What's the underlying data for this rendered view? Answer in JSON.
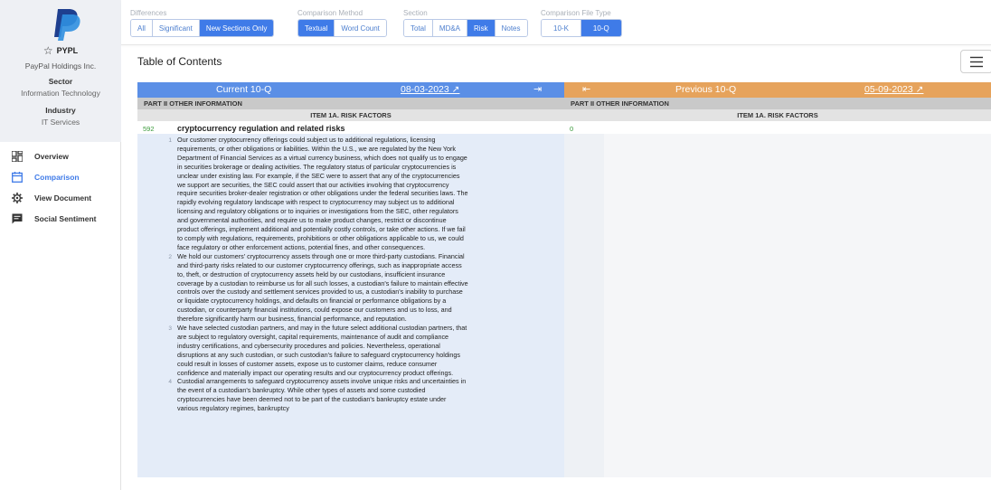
{
  "company": {
    "ticker": "PYPL",
    "name": "PayPal Holdings Inc.",
    "sector_label": "Sector",
    "sector": "Information Technology",
    "industry_label": "Industry",
    "industry": "IT Services",
    "logo_color": "#1e3f8f"
  },
  "nav": [
    {
      "label": "Overview",
      "icon": "dashboard-icon",
      "active": false
    },
    {
      "label": "Comparison",
      "icon": "calendar-icon",
      "active": true
    },
    {
      "label": "View Document",
      "icon": "gear-icon",
      "active": false
    },
    {
      "label": "Social Sentiment",
      "icon": "chat-icon",
      "active": false
    }
  ],
  "filters": {
    "differences": {
      "label": "Differences",
      "options": [
        "All",
        "Significant",
        "New Sections Only"
      ],
      "selected": "New Sections Only"
    },
    "method": {
      "label": "Comparison Method",
      "options": [
        "Textual",
        "Word Count"
      ],
      "selected": "Textual"
    },
    "section": {
      "label": "Section",
      "options": [
        "Total",
        "MD&A",
        "Risk",
        "Notes"
      ],
      "selected": "Risk"
    },
    "filetype": {
      "label": "Comparison File Type",
      "options": [
        "10-K",
        "10-Q"
      ],
      "selected": "10-Q"
    }
  },
  "toc_title": "Table of Contents",
  "current": {
    "title": "Current 10-Q",
    "date": "08-03-2023 ↗",
    "part": "PART II OTHER INFORMATION",
    "item": "ITEM 1A. RISK FACTORS",
    "section_number": "592",
    "section_title": "cryptocurrency regulation and related risks",
    "paragraphs": [
      {
        "n": "1",
        "text": "Our customer cryptocurrency offerings could subject us to additional regulations, licensing requirements, or other obligations or liabilities. Within the U.S., we are regulated by the New York Department of Financial Services as a virtual currency business, which does not qualify us to engage in securities brokerage or dealing activities. The regulatory status of particular cryptocurrencies is unclear under existing law. For example, if the SEC were to assert that any of the cryptocurrencies we support are securities, the SEC could assert that our activities involving that cryptocurrency require securities broker-dealer registration or other obligations under the federal securities laws. The rapidly evolving regulatory landscape with respect to cryptocurrency may subject us to additional licensing and regulatory obligations or to inquiries or investigations from the SEC, other regulators and governmental authorities, and require us to make product changes, restrict or discontinue product offerings, implement additional and potentially costly controls, or take other actions. If we fail to comply with regulations, requirements, prohibitions or other obligations applicable to us, we could face regulatory or other enforcement actions, potential fines, and other consequences."
      },
      {
        "n": "2",
        "text": "We hold our customers' cryptocurrency assets through one or more third-party custodians. Financial and third-party risks related to our customer cryptocurrency offerings, such as inappropriate access to, theft, or destruction of cryptocurrency assets held by our custodians, insufficient insurance coverage by a custodian to reimburse us for all such losses, a custodian's failure to maintain effective controls over the custody and settlement services provided to us, a custodian's inability to purchase or liquidate cryptocurrency holdings, and defaults on financial or performance obligations by a custodian, or counterparty financial institutions, could expose our customers and us to loss, and therefore significantly harm our business, financial performance, and reputation."
      },
      {
        "n": "3",
        "text": "We have selected custodian partners, and may in the future select additional custodian partners, that are subject to regulatory oversight, capital requirements, maintenance of audit and compliance industry certifications, and cybersecurity procedures and policies. Nevertheless, operational disruptions at any such custodian, or such custodian's failure to safeguard cryptocurrency holdings could result in losses of customer assets, expose us to customer claims, reduce consumer confidence and materially impact our operating results and our cryptocurrency product offerings."
      },
      {
        "n": "4",
        "text": "Custodial arrangements to safeguard cryptocurrency assets involve unique risks and uncertainties in the event of a custodian's bankruptcy. While other types of assets and some custodied cryptocurrencies have been deemed not to be part of the custodian's bankruptcy estate under various regulatory regimes, bankruptcy"
      }
    ]
  },
  "previous": {
    "title": "Previous 10-Q",
    "date": "05-09-2023 ↗",
    "part": "PART II OTHER INFORMATION",
    "item": "ITEM 1A. RISK FACTORS",
    "section_number": "0"
  },
  "colors": {
    "accent": "#3f7be8",
    "current_header": "#5b8fe6",
    "previous_header": "#e6a35c",
    "current_body": "#e4ecf8",
    "section_number": "#3a9a3a"
  }
}
